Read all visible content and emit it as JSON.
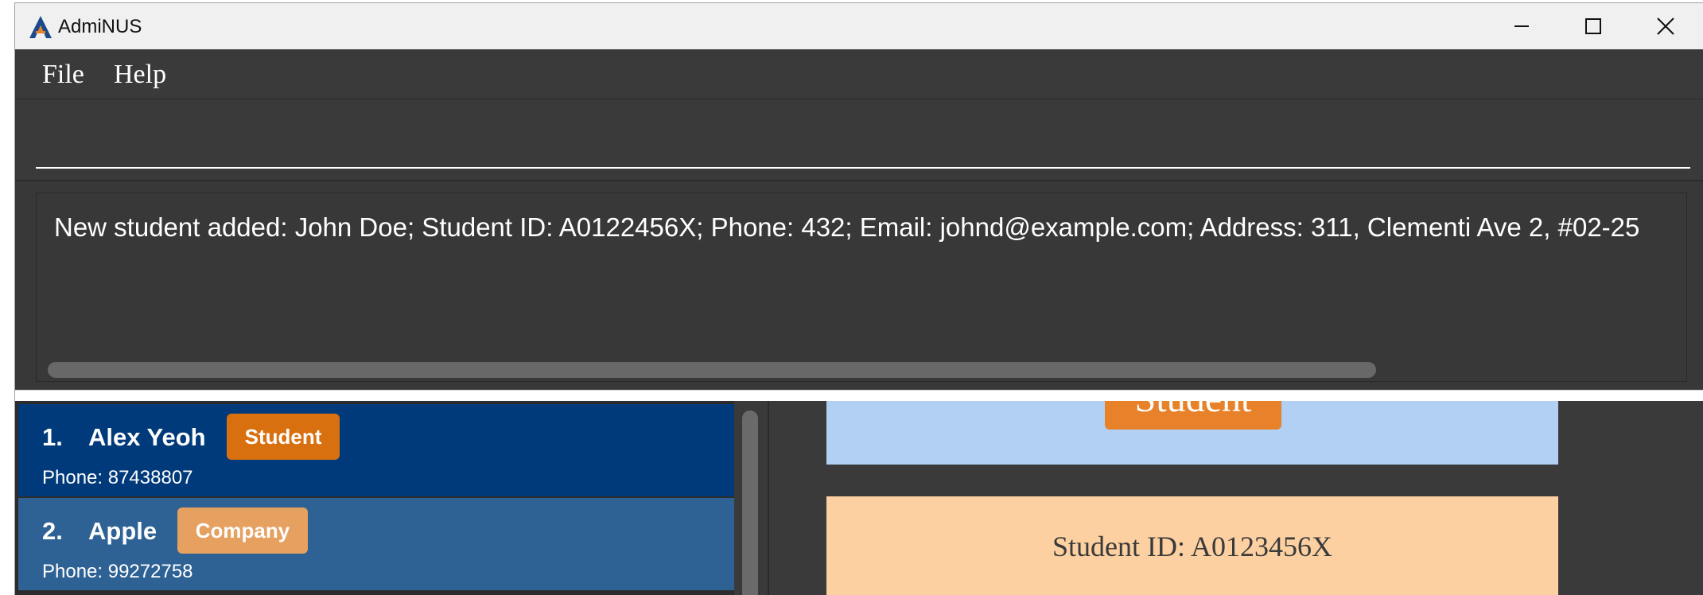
{
  "window": {
    "title": "AdmiNUS"
  },
  "menu": {
    "file": "File",
    "help": "Help"
  },
  "command": {
    "value": "",
    "placeholder": ""
  },
  "result": {
    "message": "New student added: John Doe; Student ID: A0122456X; Phone: 432; Email: johnd@example.com; Address: 311, Clementi Ave 2, #02-25"
  },
  "contacts": [
    {
      "index": "1.",
      "name": "Alex Yeoh",
      "tag": "Student",
      "phone": "Phone: 87438807",
      "tag_color": "#d97010"
    },
    {
      "index": "2.",
      "name": "Apple",
      "tag": "Company",
      "phone": "Phone: 99272758",
      "tag_color": "#e6a060"
    }
  ],
  "detail": {
    "type_badge": "Student",
    "student_id": "Student ID: A0123456X"
  },
  "colors": {
    "selected_card": "#003a7a",
    "normal_card": "#2e6194",
    "detail_header": "#b1d0f4",
    "detail_body": "#fdd0a2",
    "badge": "#e8822a"
  }
}
